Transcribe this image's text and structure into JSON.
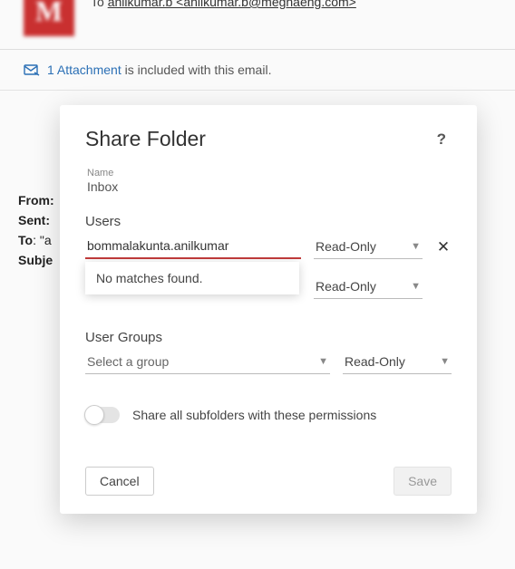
{
  "email": {
    "avatar_letter": "M",
    "to_label": "To",
    "to_display": "anilkumar.b <anilkumar.b@meghaeng.com>",
    "attachment_count_text": "1 Attachment",
    "attachment_rest": " is included with this email.",
    "meta": {
      "from_label": "From:",
      "sent_label": "Sent:",
      "to_label": "To",
      "to_value": ": \"a",
      "subj_label": "Subje"
    }
  },
  "dialog": {
    "title": "Share Folder",
    "help_symbol": "?",
    "name_label": "Name",
    "folder_name": "Inbox",
    "users_label": "Users",
    "user_input_value": "bommalakunta.anilkumar",
    "no_matches": "No matches found.",
    "perm_options_selected": "Read-Only",
    "perm_options_selected_2": "Read-Only",
    "user_groups_label": "User Groups",
    "group_placeholder": "Select a group",
    "group_perm_selected": "Read-Only",
    "toggle_label": "Share all subfolders with these permissions",
    "cancel": "Cancel",
    "save": "Save"
  }
}
